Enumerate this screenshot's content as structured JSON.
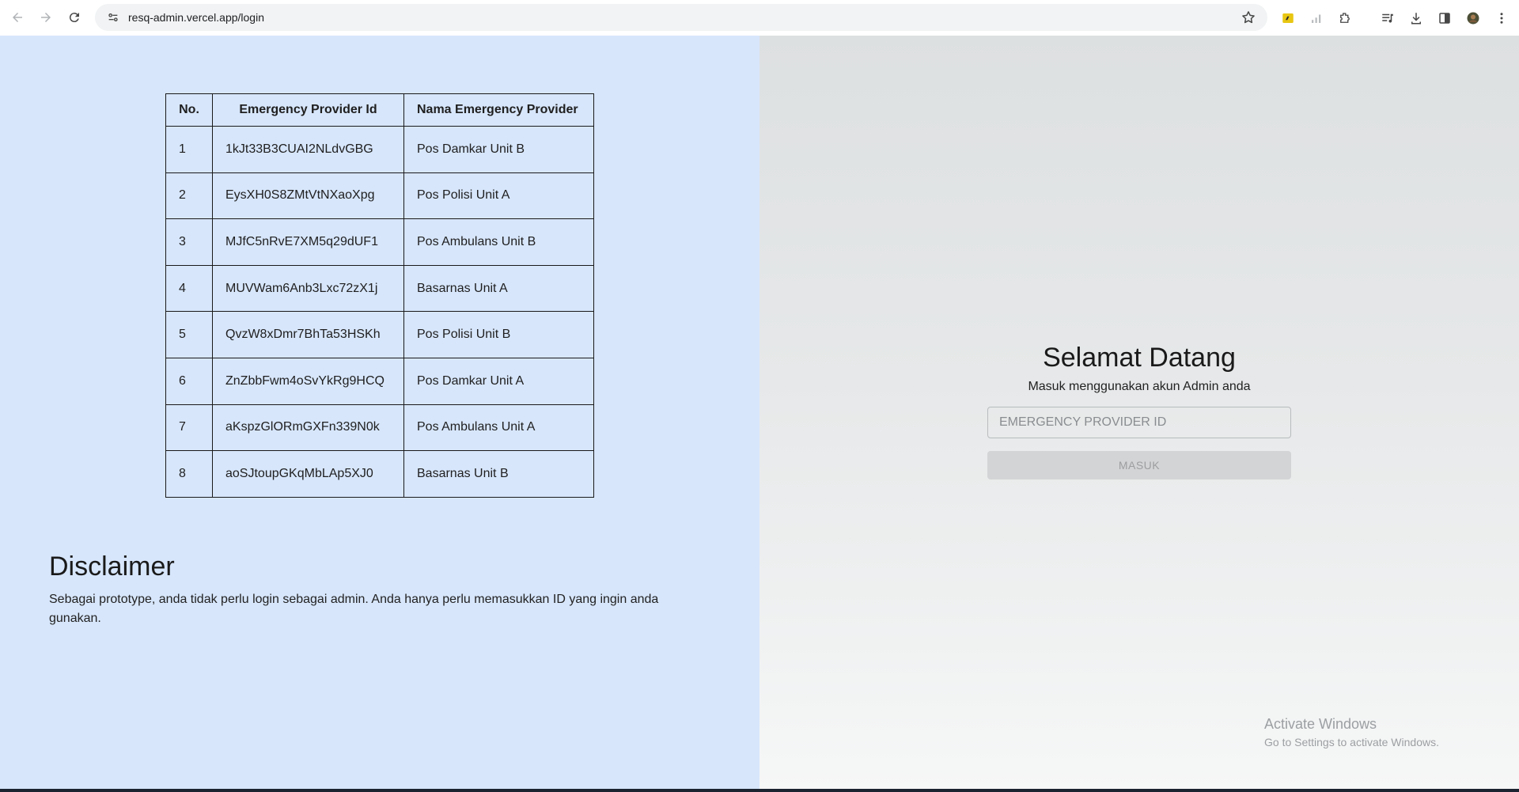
{
  "browser": {
    "url": "resq-admin.vercel.app/login",
    "icons": [
      "back-arrow-icon",
      "forward-arrow-icon",
      "reload-icon",
      "site-settings-icon",
      "bookmark-star-icon",
      "extension-icon",
      "signal-icon",
      "puzzle-icon",
      "media-icon",
      "download-icon",
      "sidebar-icon",
      "profile-avatar",
      "more-menu-icon"
    ]
  },
  "table": {
    "headers": {
      "no": "No.",
      "id": "Emergency Provider Id",
      "name": "Nama Emergency Provider"
    },
    "rows": [
      {
        "no": "1",
        "id": "1kJt33B3CUAI2NLdvGBG",
        "name": "Pos Damkar Unit B"
      },
      {
        "no": "2",
        "id": "EysXH0S8ZMtVtNXaoXpg",
        "name": "Pos Polisi Unit A"
      },
      {
        "no": "3",
        "id": "MJfC5nRvE7XM5q29dUF1",
        "name": "Pos Ambulans Unit B"
      },
      {
        "no": "4",
        "id": "MUVWam6Anb3Lxc72zX1j",
        "name": "Basarnas Unit A"
      },
      {
        "no": "5",
        "id": "QvzW8xDmr7BhTa53HSKh",
        "name": "Pos Polisi Unit B"
      },
      {
        "no": "6",
        "id": "ZnZbbFwm4oSvYkRg9HCQ",
        "name": "Pos Damkar Unit A"
      },
      {
        "no": "7",
        "id": "aKspzGlORmGXFn339N0k",
        "name": "Pos Ambulans Unit A"
      },
      {
        "no": "8",
        "id": "aoSJtoupGKqMbLAp5XJ0",
        "name": "Basarnas Unit B"
      }
    ]
  },
  "disclaimer": {
    "title": "Disclaimer",
    "text": "Sebagai prototype, anda tidak perlu login sebagai admin. Anda hanya perlu memasukkan ID yang ingin anda gunakan."
  },
  "login": {
    "title": "Selamat Datang",
    "subtitle": "Masuk menggunakan akun Admin anda",
    "input_placeholder": "EMERGENCY PROVIDER ID",
    "input_value": "",
    "submit_label": "MASUK"
  },
  "watermark": {
    "line1": "Activate Windows",
    "line2": "Go to Settings to activate Windows."
  }
}
